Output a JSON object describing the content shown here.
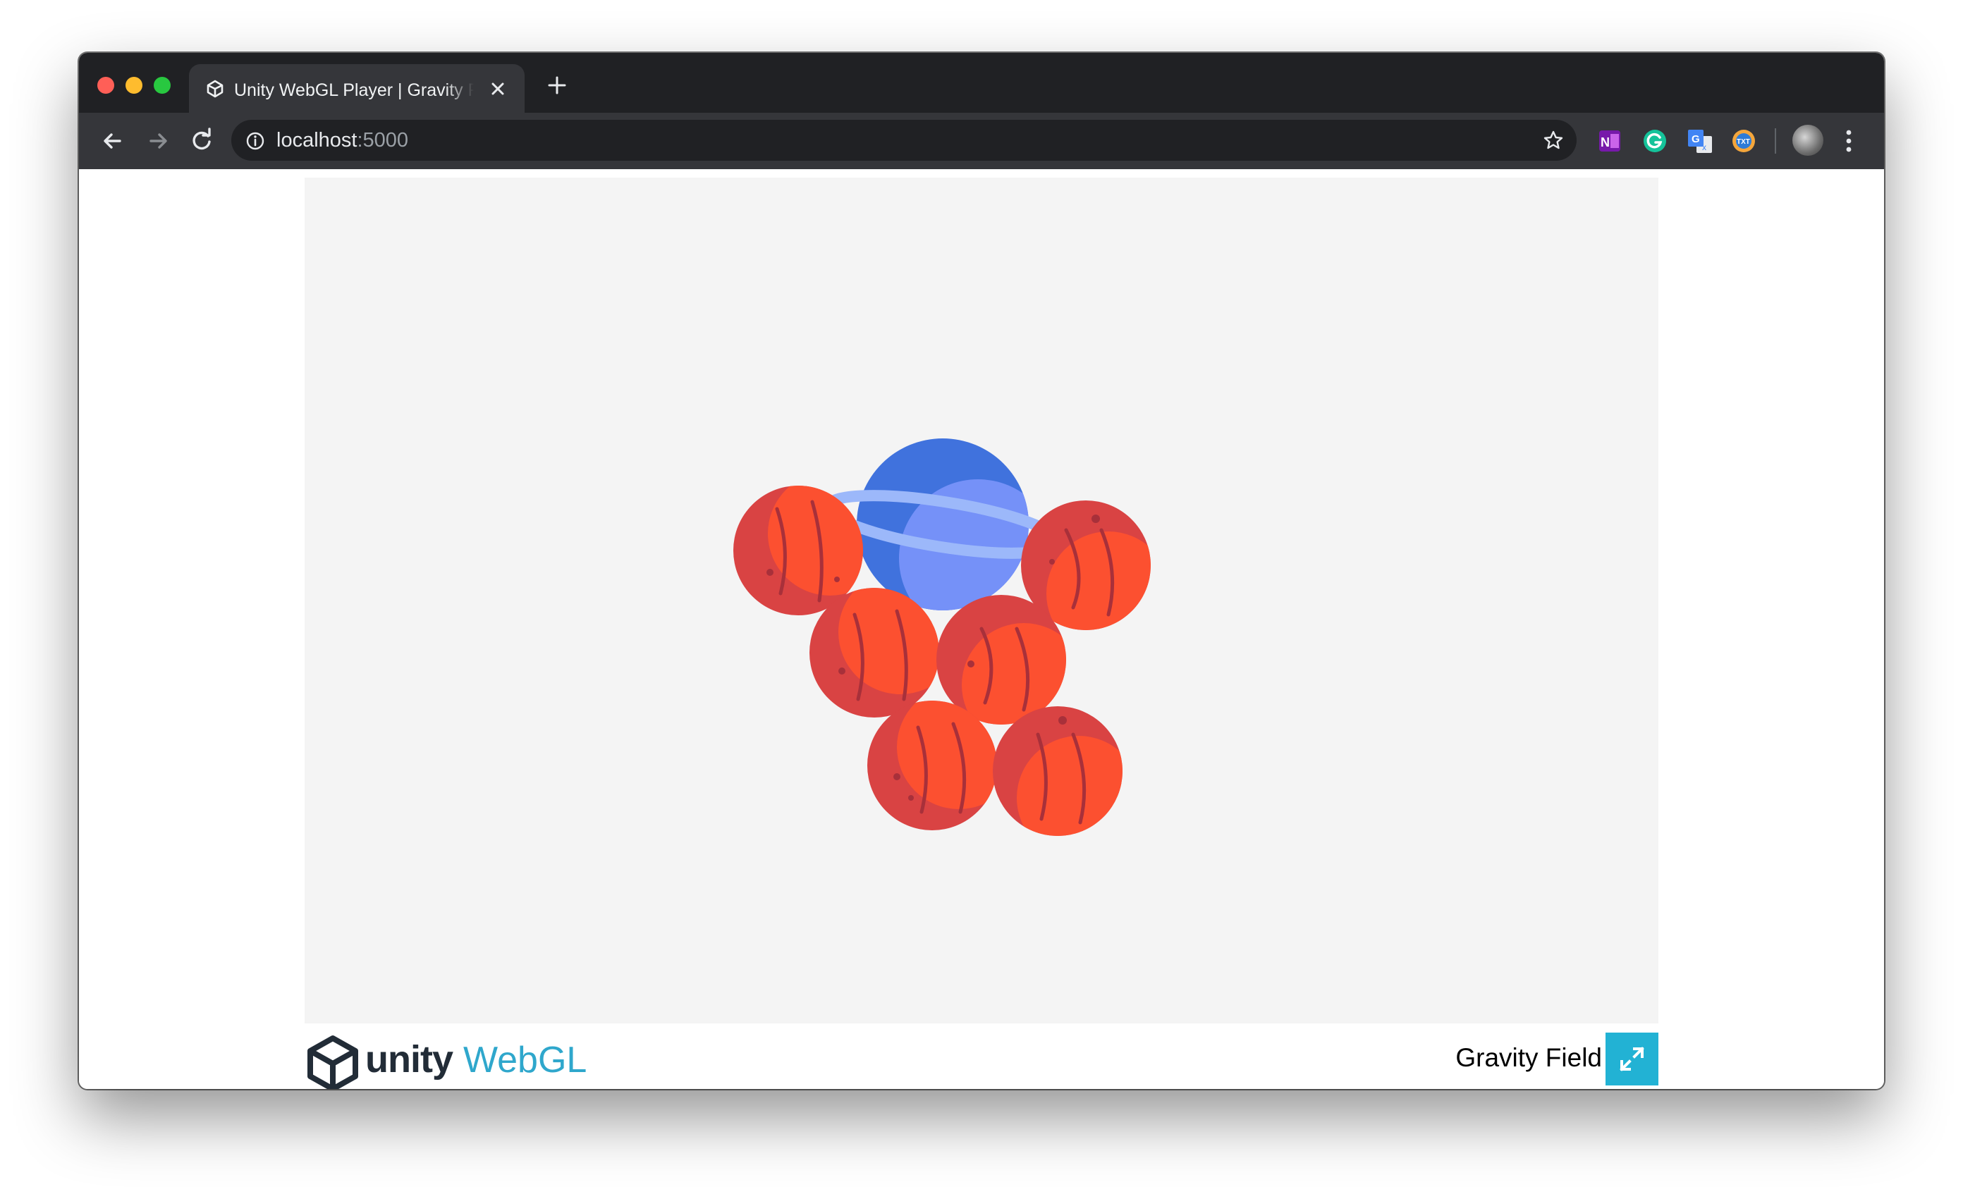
{
  "browser": {
    "tab": {
      "title": "Unity WebGL Player | Gravity Field",
      "icon": "unity-icon"
    },
    "toolbar": {
      "back_icon": "arrow-left-icon",
      "forward_icon": "arrow-right-icon",
      "reload_icon": "reload-icon",
      "url_host": "localhost",
      "url_port": ":5000",
      "bookmark_icon": "star-icon",
      "extensions": [
        "onenote-icon",
        "grammarly-icon",
        "google-translate-icon",
        "text-extension-icon"
      ],
      "menu_icon": "kebab-menu-icon"
    }
  },
  "page": {
    "canvas_background": "#f4f4f4",
    "footer": {
      "logo_word": "unity",
      "logo_product": "WebGL",
      "title": "Gravity Field",
      "fullscreen_icon": "fullscreen-icon",
      "accent_color": "#22b2d4"
    }
  },
  "game": {
    "planet_colors": {
      "mars_base": "#d94343",
      "mars_light": "#fc5030",
      "mars_crater": "#a8303a",
      "blue_dark": "#4072dd",
      "blue_light": "#7591f8",
      "ring": "#9cb8fa"
    }
  }
}
